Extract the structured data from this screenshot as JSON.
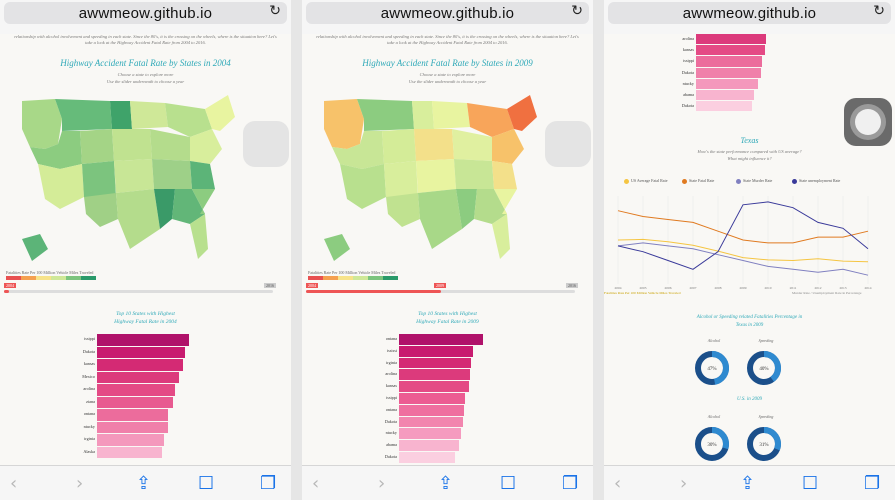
{
  "url": "awwmeow.github.io",
  "panel1": {
    "intro": "Road traffic safety is one of the biggest concerns in the United. This visualization presents to users the number of fatal accidents and the relationship with alcohol involvement and speeding in each state. Since the 80's, it is the crossing on the wheels, where is the situation here? Let's take a look at the Highway Accident Fatal Rate from 2004 to 2016.",
    "title": "Highway Accident Fatal Rate by States in 2004",
    "sub1": "Choose a state to explore more",
    "sub2": "Use the slider underneath to choose a year",
    "legend_label": "Fatalities Rate Per 100 Million Vehicle Miles Traveled",
    "slider_start": "2004",
    "slider_end": "2016",
    "slider_value": 0.02,
    "bar_title_1": "Top 10 States with Highest",
    "bar_title_2": "Highway Fatal Rate in 2004",
    "bars": [
      {
        "state": "issippi",
        "value": 2.2,
        "color": "#b0126a"
      },
      {
        "state": "Dakota",
        "value": 2.1,
        "color": "#c81b6f"
      },
      {
        "state": "kansas",
        "value": 2.05,
        "color": "#d42a74"
      },
      {
        "state": "Mexico",
        "value": 1.95,
        "color": "#dc3a7c"
      },
      {
        "state": "arolina",
        "value": 1.85,
        "color": "#e44a85"
      },
      {
        "state": "ziana",
        "value": 1.8,
        "color": "#e85a90"
      },
      {
        "state": "ontana",
        "value": 1.7,
        "color": "#ec6c9c"
      },
      {
        "state": "ntucky",
        "value": 1.68,
        "color": "#f080aa"
      },
      {
        "state": "irginia",
        "value": 1.6,
        "color": "#f498bc"
      },
      {
        "state": "Alaska",
        "value": 1.55,
        "color": "#f8b4cf"
      }
    ]
  },
  "panel2": {
    "intro": "Road traffic safety is one of the biggest concerns in the United. This visualization presents to users the number of fatal accidents and the relationship with alcohol involvement and speeding in each state. Since the 80's, it is the crossing on the wheels, where is the situation here? Let's take a look at the Highway Accident Fatal Rate from 2004 to 2016.",
    "title": "Highway Accident Fatal Rate by States in 2009",
    "sub1": "Choose a state to explore more",
    "sub2": "Use the slider underneath to choose a year",
    "legend_label": "Fatalities Rate Per 100 Million Vehicle Miles Traveled",
    "slider_start": "2004",
    "slider_year": "2009",
    "slider_end": "2016",
    "slider_value": 0.5,
    "bar_title_1": "Top 10 States with Highest",
    "bar_title_2": "Highway Fatal Rate in 2009",
    "bars": [
      {
        "state": "ontana",
        "value": 2.1,
        "color": "#b0126a"
      },
      {
        "state": "ississi",
        "value": 1.85,
        "color": "#c81b6f"
      },
      {
        "state": "irginia",
        "value": 1.8,
        "color": "#d42a74"
      },
      {
        "state": "arolina",
        "value": 1.78,
        "color": "#dc3a7c"
      },
      {
        "state": "kansas",
        "value": 1.75,
        "color": "#e44a85"
      },
      {
        "state": "issippi",
        "value": 1.65,
        "color": "#ec5c92"
      },
      {
        "state": "ontana",
        "value": 1.63,
        "color": "#ef6f9f"
      },
      {
        "state": "Dakota",
        "value": 1.6,
        "color": "#f285ae"
      },
      {
        "state": "ntucky",
        "value": 1.55,
        "color": "#f59bbf"
      },
      {
        "state": "abama",
        "value": 1.5,
        "color": "#f8b4cf"
      },
      {
        "state": "Dakota",
        "value": 1.4,
        "color": "#fbcfe0"
      }
    ]
  },
  "panel3": {
    "bars": [
      {
        "state": "arolina",
        "value": 1.75,
        "color": "#dc3a7c"
      },
      {
        "state": "kansas",
        "value": 1.72,
        "color": "#e44a85"
      },
      {
        "state": "issippi",
        "value": 1.65,
        "color": "#ec6c9c"
      },
      {
        "state": "Dakota",
        "value": 1.63,
        "color": "#f080aa"
      },
      {
        "state": "ntucky",
        "value": 1.55,
        "color": "#f498bc"
      },
      {
        "state": "abama",
        "value": 1.45,
        "color": "#f8b4cf"
      },
      {
        "state": "Dakota",
        "value": 1.4,
        "color": "#fbcfe0"
      }
    ],
    "texas_title": "Texas",
    "texas_sub1": "How's the state performance compared with US average?",
    "texas_sub2": "What might influence it?",
    "legend": [
      {
        "label": "US Average Fatal Rate",
        "color": "#f5c542"
      },
      {
        "label": "State Fatal Rate",
        "color": "#e07a20"
      },
      {
        "label": "State Murder Rate",
        "color": "#8080c0"
      },
      {
        "label": "State unemployment Rate",
        "color": "#3a3a9a"
      }
    ],
    "left_axis_label": "Fatalities Rate Per 100 Million Vehicle Miles Traveled",
    "right_axis_label": "Murder Rate / Unemployment Rate in Percentage",
    "donut_title_1": "Alcohol or Speeding related Fatalities Percentage in",
    "donut_title_2": "Texas in 2009",
    "alcohol_label": "Alcohol",
    "speeding_label": "Speeding",
    "donut1_alcohol": "47%",
    "donut1_speeding": "40%",
    "us_title": "U.S. in 2009",
    "donut2_alcohol": "30%",
    "donut2_speeding": "31%"
  },
  "chart_data": {
    "type": "line",
    "x": [
      "2004",
      "2005",
      "2006",
      "2007",
      "2008",
      "2009",
      "2010",
      "2011",
      "2012",
      "2013",
      "2014"
    ],
    "series": [
      {
        "name": "US Average Fatal Rate",
        "values": [
          1.45,
          1.46,
          1.42,
          1.36,
          1.26,
          1.15,
          1.11,
          1.1,
          1.13,
          1.09,
          1.08
        ]
      },
      {
        "name": "State Fatal Rate",
        "values": [
          1.95,
          1.85,
          1.8,
          1.75,
          1.6,
          1.45,
          1.4,
          1.4,
          1.5,
          1.5,
          1.6
        ]
      },
      {
        "name": "State Murder Rate",
        "values": [
          1.35,
          1.4,
          1.35,
          1.3,
          1.2,
          1.1,
          1.0,
          0.95,
          0.9,
          0.95,
          0.85
        ]
      },
      {
        "name": "State unemployment Rate",
        "values": [
          1.35,
          1.25,
          1.1,
          0.95,
          1.25,
          2.05,
          2.1,
          2.0,
          1.75,
          1.65,
          1.3
        ]
      }
    ]
  },
  "colors": {
    "accent": "#2fa9b8",
    "toolbar_blue": "#1a73e8"
  }
}
